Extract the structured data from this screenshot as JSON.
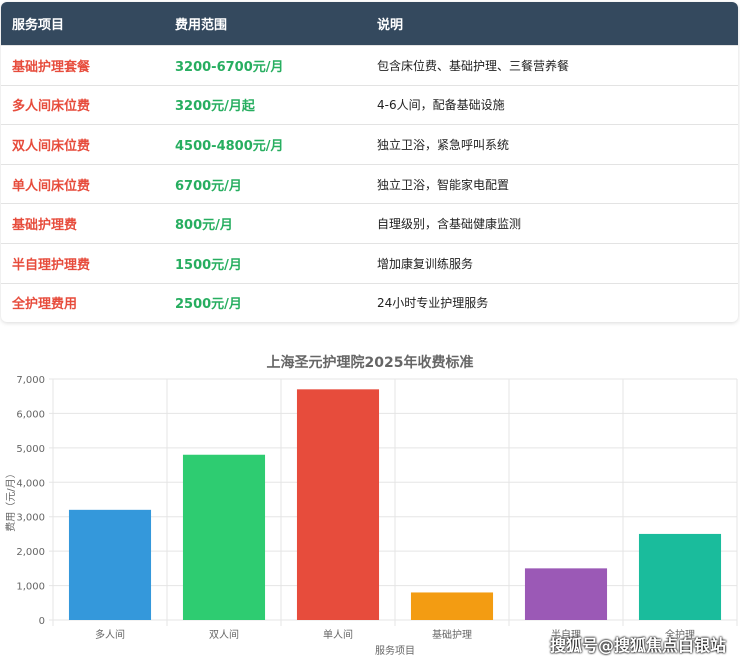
{
  "table": {
    "headers": [
      "服务项目",
      "费用范围",
      "说明"
    ],
    "rows": [
      [
        "基础护理套餐",
        "3200-6700元/月",
        "包含床位费、基础护理、三餐营养餐"
      ],
      [
        "多人间床位费",
        "3200元/月起",
        "4-6人间，配备基础设施"
      ],
      [
        "双人间床位费",
        "4500-4800元/月",
        "独立卫浴，紧急呼叫系统"
      ],
      [
        "单人间床位费",
        "6700元/月",
        "独立卫浴，智能家电配置"
      ],
      [
        "基础护理费",
        "800元/月",
        "自理级别，含基础健康监测"
      ],
      [
        "半自理护理费",
        "1500元/月",
        "增加康复训练服务"
      ],
      [
        "全护理费用",
        "2500元/月",
        "24小时专业护理服务"
      ]
    ]
  },
  "chart_data": {
    "type": "bar",
    "title": "上海圣元护理院2025年收费标准",
    "xlabel": "服务项目",
    "ylabel": "费用（元/月）",
    "categories": [
      "多人间",
      "双人间",
      "单人间",
      "基础护理",
      "半自理",
      "全护理"
    ],
    "values": [
      3200,
      4800,
      6700,
      800,
      1500,
      2500
    ],
    "colors": [
      "#3498db",
      "#2ecc71",
      "#e74c3c",
      "#f39c12",
      "#9b59b6",
      "#1abc9c"
    ],
    "ylim": [
      0,
      7000
    ],
    "yticks": [
      "0",
      "1,000",
      "2,000",
      "3,000",
      "4,000",
      "5,000",
      "6,000",
      "7,000"
    ],
    "grid": true
  },
  "watermark": "搜狐号@搜狐焦点白银站"
}
